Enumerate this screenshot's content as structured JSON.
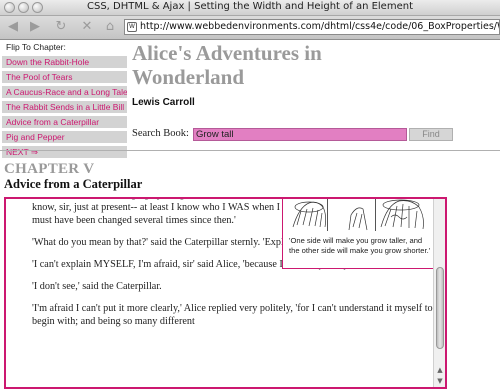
{
  "window": {
    "title": "CSS, DHTML & Ajax | Setting the Width and Height of an Element"
  },
  "toolbar": {
    "back_icon": "back-arrow-icon",
    "forward_icon": "forward-arrow-icon",
    "reload_icon": "reload-icon",
    "stop_icon": "stop-icon",
    "home_icon": "home-icon",
    "url": "http://www.webbedenvironments.com/dhtml/css4e/code/06_BoxProperties/WidthHeig"
  },
  "nav": {
    "heading": "Flip To Chapter:",
    "items": [
      "Down the Rabbit-Hole",
      "The Pool of Tears",
      "A Caucus-Race and a Long Tale",
      "The Rabbit Sends in a Little Bill",
      "Advice from a Caterpillar",
      "Pig and Pepper",
      "NEXT ⇒"
    ]
  },
  "header": {
    "title": "Alice's Adventures in Wonderland",
    "author": "Lewis Carroll"
  },
  "search": {
    "label": "Search Book:",
    "value": "Grow tall",
    "button": "Find"
  },
  "chapter": {
    "number": "CHAPTER V",
    "title": "Advice from a Caterpillar"
  },
  "figure": {
    "caption": "'One side will make you grow taller, and the other side will make you grow shorter.'"
  },
  "content": {
    "paragraphs": [
      "This was not an encouraging opening for a conversation. Alice replied, rather shyly, 'I--I hardly know, sir, just at present-- at least I know who I WAS when I got up this morning, but I think I must have been changed several times since then.'",
      "'What do you mean by that?' said the Caterpillar sternly. 'Explain yourself!'",
      "'I can't explain MYSELF, I'm afraid, sir' said Alice, 'because I'm not myself, you see.'",
      "'I don't see,' said the Caterpillar.",
      "'I'm afraid I can't put it more clearly,' Alice replied very politely, 'for I can't understand it myself to begin with; and being so many different"
    ]
  },
  "colors": {
    "accent": "#cc1870",
    "search_field": "#e27fc2",
    "nav_bg": "#d3d3d3",
    "title_gray": "#9a9a9a"
  }
}
